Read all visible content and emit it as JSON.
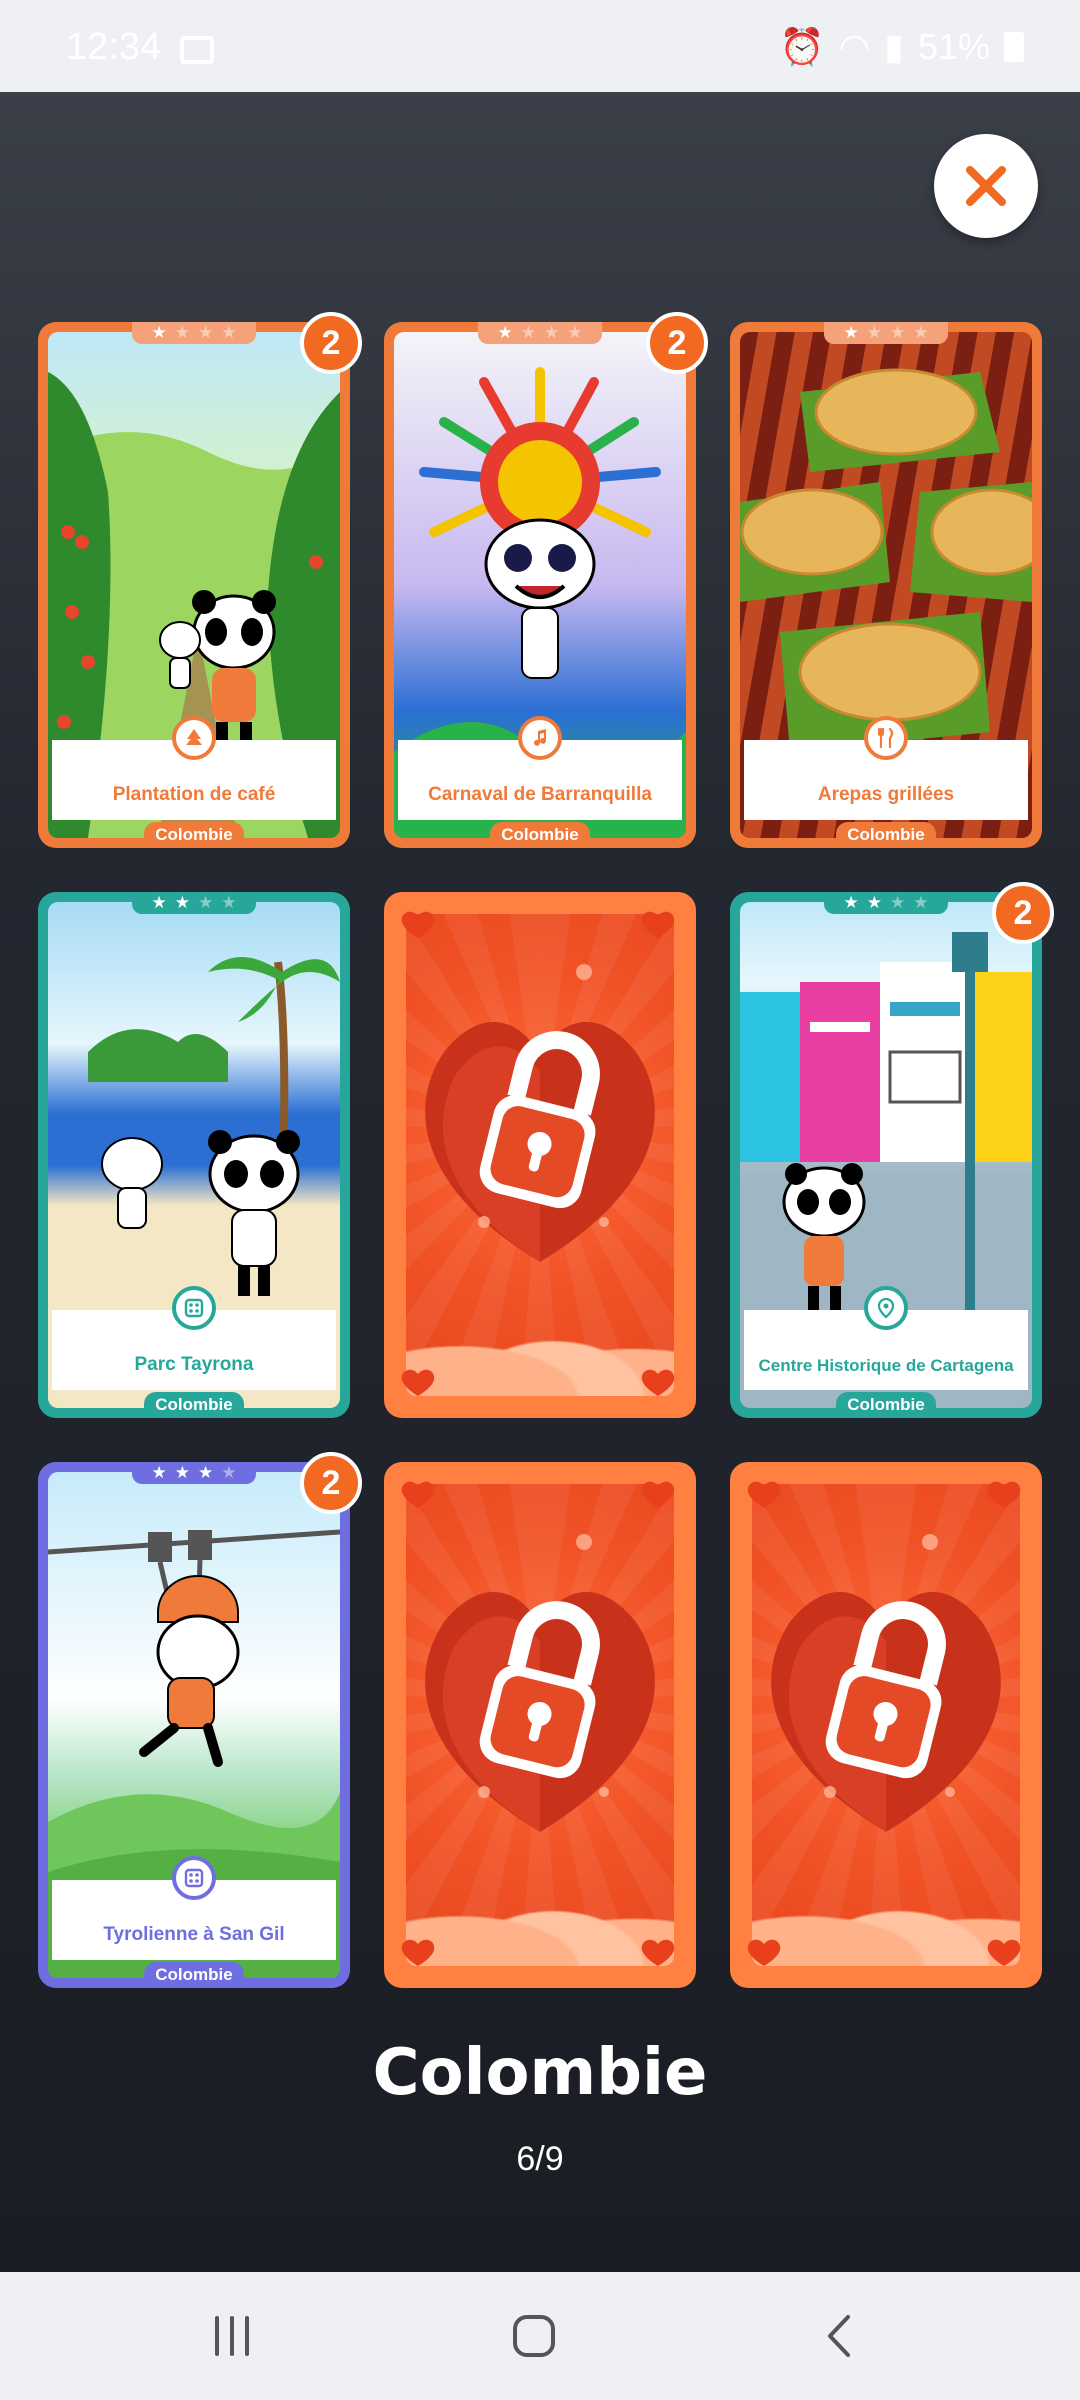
{
  "status_bar": {
    "time": "12:34",
    "battery": "51%"
  },
  "collection": {
    "title": "Colombie",
    "progress": "6/9"
  },
  "cards": [
    {
      "name": "Plantation de café",
      "country": "Colombie",
      "badge": "2",
      "stars_filled": 1,
      "stars_total": 4,
      "theme": "#f07a3a",
      "icon": "tree-icon"
    },
    {
      "name": "Carnaval de Barranquilla",
      "country": "Colombie",
      "badge": "2",
      "stars_filled": 1,
      "stars_total": 4,
      "theme": "#f07a3a",
      "icon": "music-note-icon"
    },
    {
      "name": "Arepas grillées",
      "country": "Colombie",
      "badge": "",
      "stars_filled": 1,
      "stars_total": 4,
      "theme": "#f07a3a",
      "icon": "fork-knife-icon"
    },
    {
      "name": "Parc Tayrona",
      "country": "Colombie",
      "badge": "",
      "stars_filled": 2,
      "stars_total": 4,
      "theme": "#26a79a",
      "icon": "dice-icon"
    },
    {
      "locked": true,
      "icon": "padlock-heart-icon"
    },
    {
      "name": "Centre Historique de Cartagena",
      "country": "Colombie",
      "badge": "2",
      "stars_filled": 2,
      "stars_total": 4,
      "theme": "#26a79a",
      "icon": "map-pin-icon"
    },
    {
      "name": "Tyrolienne à San Gil",
      "country": "Colombie",
      "badge": "2",
      "stars_filled": 3,
      "stars_total": 4,
      "theme": "#6e6ee0",
      "icon": "dice-icon"
    },
    {
      "locked": true,
      "icon": "padlock-heart-icon"
    },
    {
      "locked": true,
      "icon": "padlock-heart-icon"
    }
  ],
  "colors": {
    "accent": "#f26a21",
    "locked": "#f05226",
    "background": "#1d2028"
  }
}
